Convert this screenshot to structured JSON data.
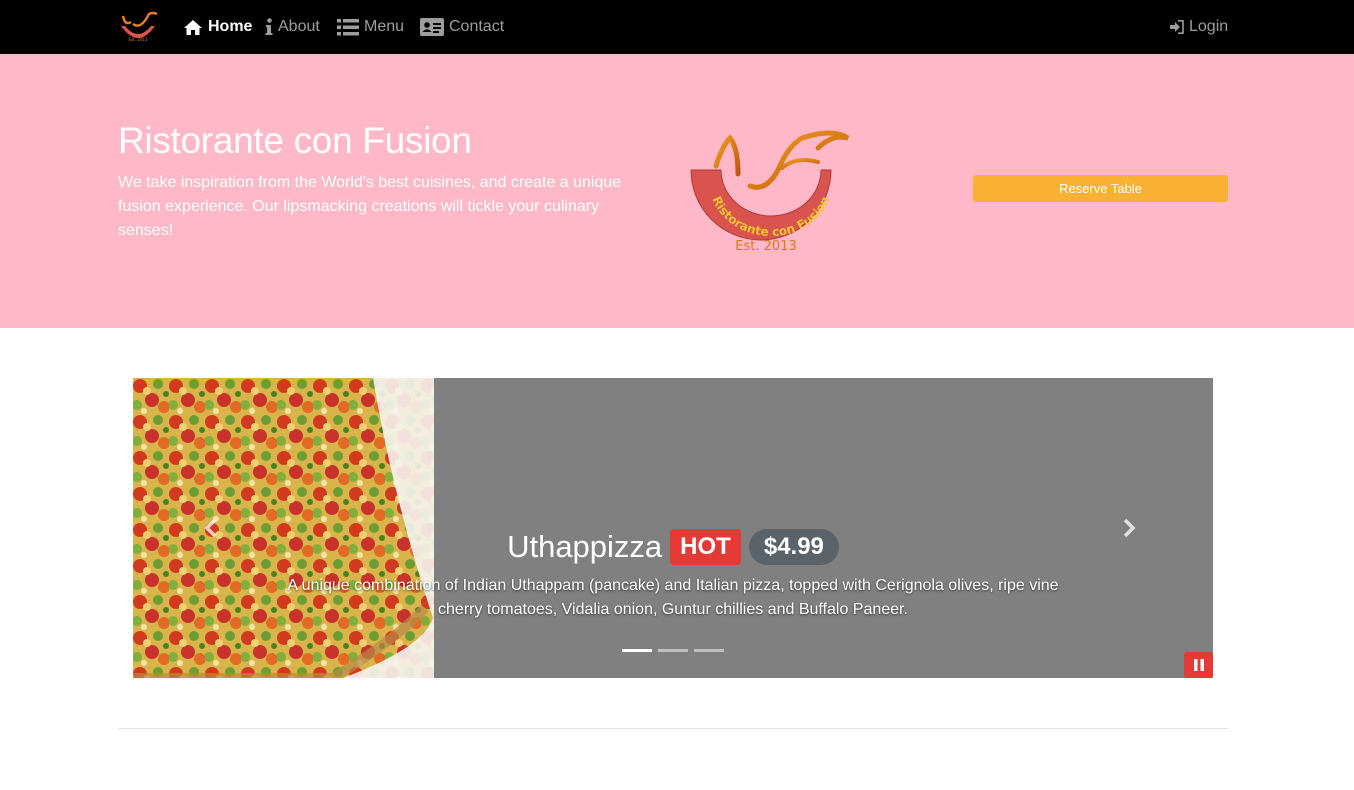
{
  "navbar": {
    "items": [
      {
        "label": "Home",
        "icon": "home-icon",
        "active": true
      },
      {
        "label": "About",
        "icon": "info-icon",
        "active": false
      },
      {
        "label": "Menu",
        "icon": "list-icon",
        "active": false
      },
      {
        "label": "Contact",
        "icon": "address-card-icon",
        "active": false
      }
    ],
    "login_label": "Login"
  },
  "jumbotron": {
    "title": "Ristorante con Fusion",
    "description": "We take inspiration from the World's best cuisines, and create a unique fusion experience. Our lipsmacking creations will tickle your culinary senses!",
    "logo_text": "Ristorante con Fusion",
    "logo_est": "Est. 2013",
    "reserve_label": "Reserve Table"
  },
  "carousel": {
    "slides": [
      {
        "name": "Uthappizza",
        "badge": "HOT",
        "price": "$4.99",
        "description": "A unique combination of Indian Uthappam (pancake) and Italian pizza, topped with Cerignola olives, ripe vine cherry tomatoes, Vidalia onion, Guntur chillies and Buffalo Paneer."
      }
    ],
    "active_index": 0,
    "indicator_count": 3
  },
  "colors": {
    "navbar_bg": "#000000",
    "jumbotron_bg": "#ffb8c7",
    "reserve_button": "#f8b133",
    "badge_hot": "#e53935",
    "badge_price": "#5b636a",
    "carousel_bg": "#808080"
  }
}
